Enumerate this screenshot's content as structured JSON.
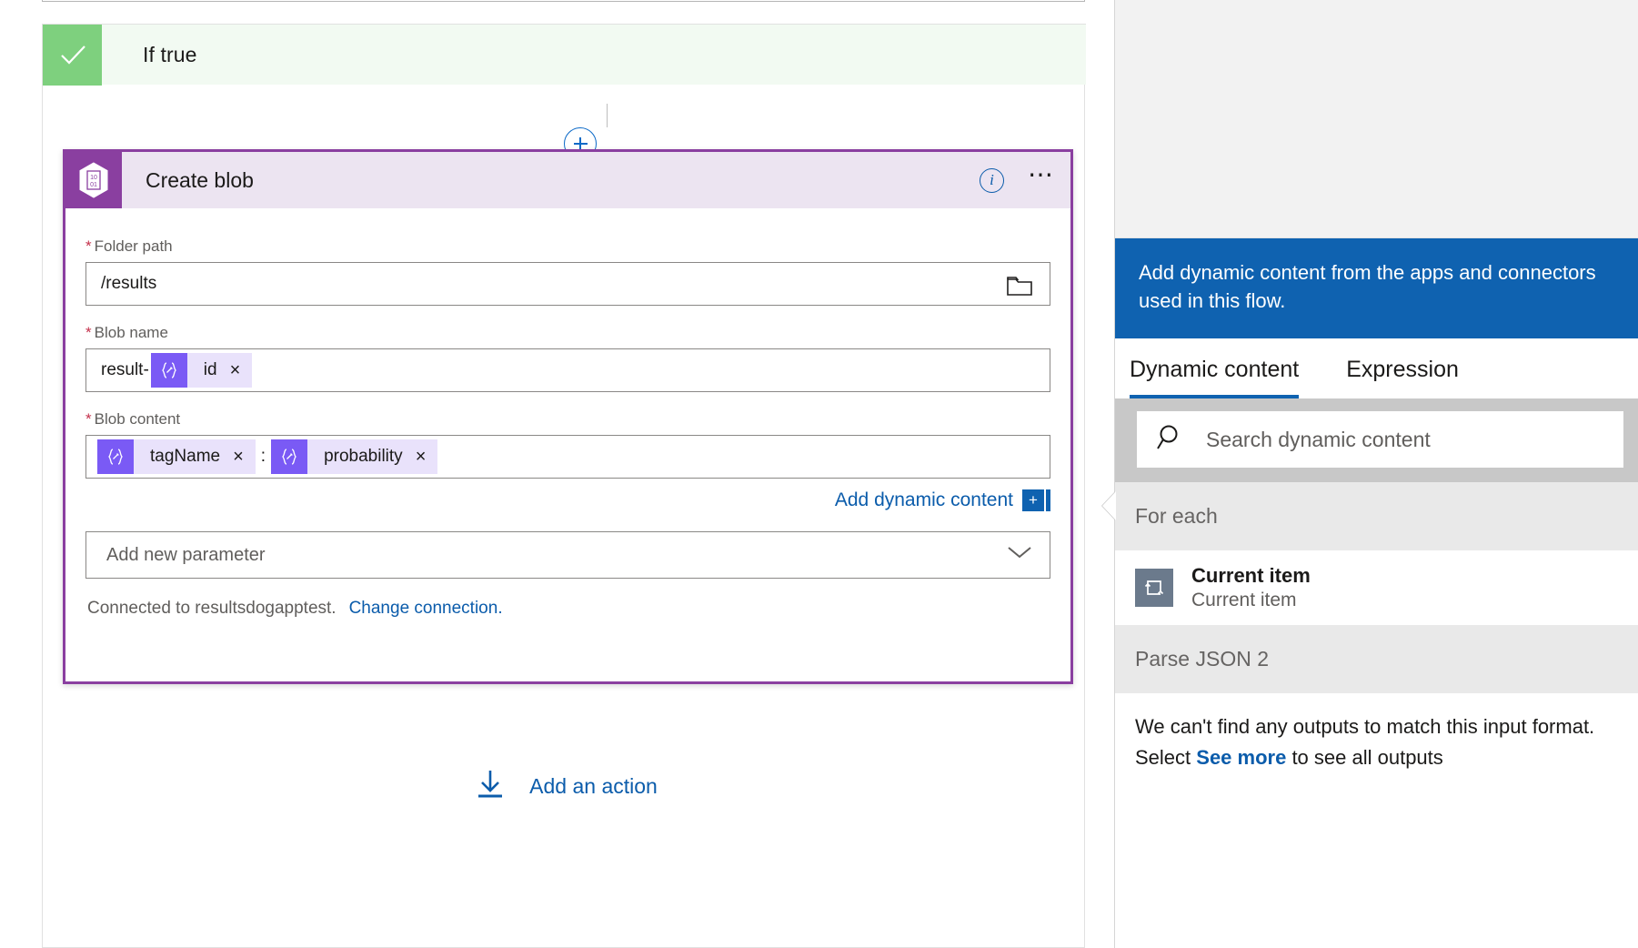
{
  "scope": {
    "title": "If true",
    "check_icon": "checkmark-icon"
  },
  "add_node": {
    "icon": "plus-icon"
  },
  "card": {
    "title": "Create blob",
    "icon": "blob-binary-icon",
    "info_icon": "info-icon",
    "more_icon": "more-options-icon",
    "fields": [
      {
        "label": "Folder path",
        "required_marker": "*",
        "value": "/results",
        "trailing_icon": "folder-picker-icon"
      },
      {
        "label": "Blob name",
        "required_marker": "*",
        "prefix_text": "result-",
        "tokens": [
          {
            "glyph": "{∘}",
            "label": "id",
            "remove": "×"
          }
        ]
      },
      {
        "label": "Blob content",
        "required_marker": "*",
        "tokens": [
          {
            "glyph": "{∘}",
            "label": "tagName",
            "remove": "×"
          },
          {
            "glyph": "{∘}",
            "label": "probability",
            "remove": "×"
          }
        ],
        "separator": ":"
      }
    ],
    "add_dynamic_content": {
      "label": "Add dynamic content",
      "plus": "+"
    },
    "add_parameter": {
      "label": "Add new parameter",
      "chevron_icon": "chevron-down-icon"
    },
    "connection": {
      "text": "Connected to resultsdogapptest.",
      "change_link": "Change connection."
    }
  },
  "add_action": {
    "label": "Add an action",
    "icon": "add-action-icon"
  },
  "flyout": {
    "banner": "Add dynamic content from the apps and connectors used in this flow.",
    "tabs": [
      {
        "label": "Dynamic content",
        "active": true
      },
      {
        "label": "Expression",
        "active": false
      }
    ],
    "search": {
      "placeholder": "Search dynamic content",
      "icon": "search-icon"
    },
    "groups": [
      {
        "name": "For each",
        "items": [
          {
            "name": "Current item",
            "description": "Current item",
            "icon": "loop-item-icon"
          }
        ]
      },
      {
        "name": "Parse JSON 2",
        "empty_message_1": "We can't find any outputs to match this input format.",
        "empty_message_2_prefix": "Select ",
        "empty_message_2_link": "See more",
        "empty_message_2_suffix": " to see all outputs"
      }
    ]
  },
  "colors": {
    "accent_purple": "#8a3fa0",
    "token_purple": "#7a5af5",
    "link_blue": "#0b5cab",
    "banner_blue": "#0f62b0",
    "success_green": "#7ed07e"
  }
}
